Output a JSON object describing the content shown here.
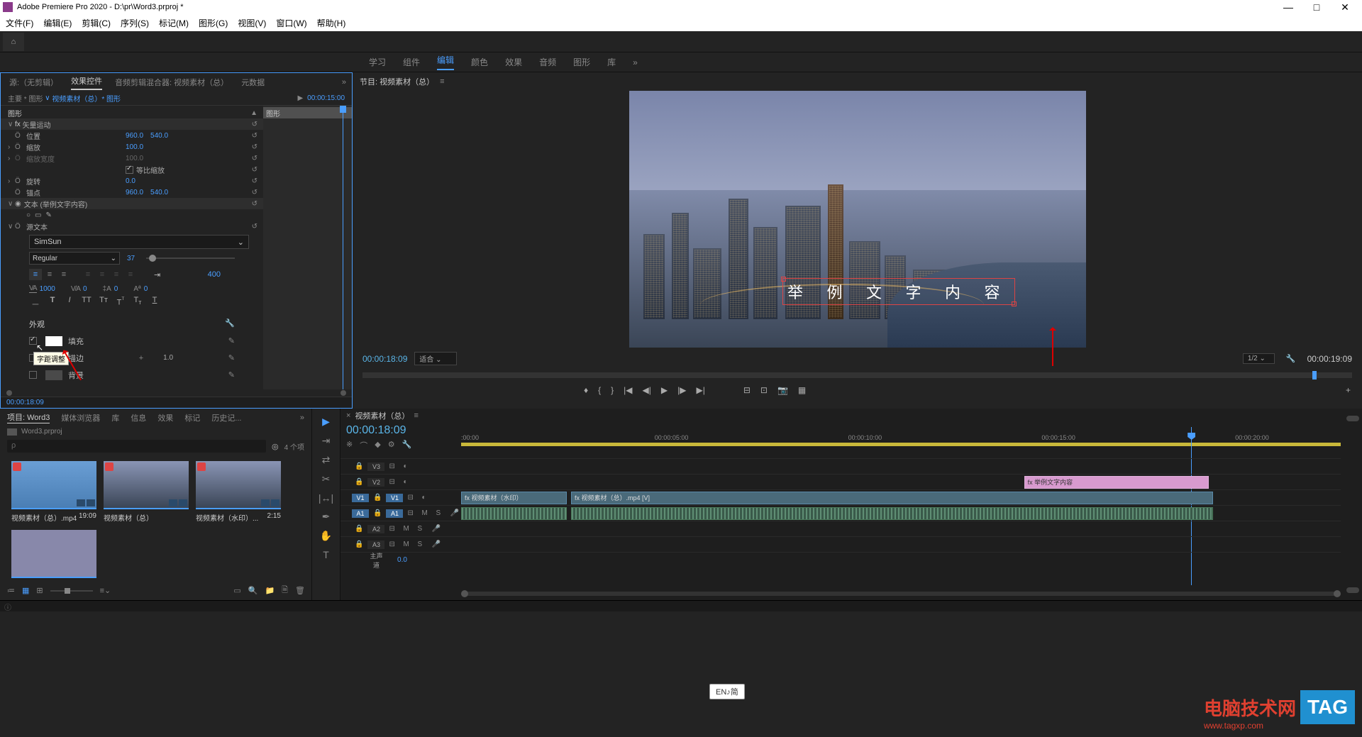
{
  "app": {
    "title": "Adobe Premiere Pro 2020 - D:\\pr\\Word3.prproj *",
    "menus": [
      "文件(F)",
      "编辑(E)",
      "剪辑(C)",
      "序列(S)",
      "标记(M)",
      "图形(G)",
      "视图(V)",
      "窗口(W)",
      "帮助(H)"
    ]
  },
  "workspace_tabs": {
    "items": [
      "学习",
      "组件",
      "编辑",
      "颜色",
      "效果",
      "音频",
      "图形",
      "库"
    ],
    "active": "编辑",
    "more": "»"
  },
  "effect_controls": {
    "tabs": {
      "source": "源:（无剪辑）",
      "effect": "效果控件",
      "mixer": "音频剪辑混合器: 视频素材（总）",
      "meta": "元数据"
    },
    "breadcrumb": {
      "main": "主要 * 图形",
      "sep": "∨",
      "link": "视频素材（总）* 图形"
    },
    "preview_tc": "00:00:15:00",
    "section_graphics": "图形",
    "clip_label": "图形",
    "vector_motion": "矢量运动",
    "position": {
      "label": "位置",
      "x": "960.0",
      "y": "540.0"
    },
    "scale": {
      "label": "缩放",
      "v": "100.0"
    },
    "scale_w": {
      "label": "缩放宽度",
      "v": "100.0"
    },
    "uniform": "等比缩放",
    "rotation": {
      "label": "旋转",
      "v": "0.0"
    },
    "anchor": {
      "label": "锚点",
      "x": "960.0",
      "y": "540.0"
    },
    "text_section": "文本 (举例文字内容)",
    "source_text": "源文本",
    "font": "SimSun",
    "font_style": "Regular",
    "font_size": "37",
    "indent": "400",
    "tracking": {
      "v": "1000",
      "v2": "0",
      "leading": "0",
      "baseline": "0"
    },
    "tooltip": "字距调整",
    "appearance": "外观",
    "fill": "填充",
    "stroke": "描边",
    "stroke_val": "1.0",
    "bg": "背景",
    "footer_tc": "00:00:18:09"
  },
  "program": {
    "title": "节目: 视频素材（总）",
    "overlay_text": "举 例 文 字 内 容",
    "tc": "00:00:18:09",
    "fit": "适合",
    "resolution": "1/2",
    "duration": "00:00:19:09"
  },
  "project": {
    "tabs": [
      "项目: Word3",
      "媒体浏览器",
      "库",
      "信息",
      "效果",
      "标记",
      "历史记..."
    ],
    "bin": "Word3.prproj",
    "search_placeholder": "ρ",
    "count": "4 个项",
    "items": [
      {
        "label": "视频素材（总）.mp4",
        "dur": "19:09"
      },
      {
        "label": "视频素材（总）",
        "dur": ""
      },
      {
        "label": "视频素材（水印）...",
        "dur": "2:15"
      }
    ]
  },
  "timeline": {
    "title": "视频素材（总）",
    "tc": "00:00:18:09",
    "ticks": [
      ":00:00",
      "00:00:05:00",
      "00:00:10:00",
      "00:00:15:00",
      "00:00:20:00"
    ],
    "tracks": {
      "v3": "V3",
      "v2": "V2",
      "v1": "V1",
      "a1": "A1",
      "a2": "A2",
      "a3": "A3",
      "master": "主声道",
      "master_val": "0.0"
    },
    "clips": {
      "v1a": "视频素材（水印）",
      "v1b": "视频素材（总）.mp4 [V]",
      "graphic": "举例文字内容"
    }
  },
  "ime": "EN♪简",
  "watermark": {
    "cn": "电脑技术网",
    "url": "www.tagxp.com",
    "tag": "TAG"
  }
}
